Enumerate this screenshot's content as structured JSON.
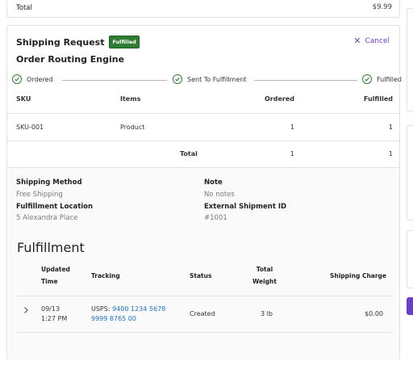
{
  "summary": {
    "total_label": "Total",
    "total_value": "$9.99"
  },
  "shipping_request": {
    "title": "Shipping Request",
    "badge": "Fulfilled",
    "cancel_label": "Cancel",
    "subtitle": "Order Routing Engine",
    "steps": [
      "Ordered",
      "Sent To Fulfillment",
      "Fulfilled"
    ],
    "status_colors": {
      "fulfilled": "#2e7d32",
      "accent": "#6a3ec7",
      "link": "#1a73c8"
    }
  },
  "items_table": {
    "headers": [
      "SKU",
      "Items",
      "Ordered",
      "Fulfilled"
    ],
    "rows": [
      {
        "sku": "SKU-001",
        "item": "Product",
        "ordered": "1",
        "fulfilled": "1"
      }
    ],
    "total": {
      "label": "Total",
      "ordered": "1",
      "fulfilled": "1"
    }
  },
  "details": {
    "shipping_method_label": "Shipping Method",
    "shipping_method": "Free Shipping",
    "note_label": "Note",
    "note": "No notes",
    "fulfillment_location_label": "Fulfillment Location",
    "fulfillment_location": "5 Alexandra Place",
    "external_id_label": "External Shipment ID",
    "external_id": "#1001"
  },
  "fulfillment": {
    "title": "Fulfillment",
    "headers": {
      "updated_time_1": "Updated",
      "updated_time_2": "Time",
      "tracking": "Tracking",
      "status": "Status",
      "total_weight_1": "Total",
      "total_weight_2": "Weight",
      "shipping_charge": "Shipping Charge"
    },
    "rows": [
      {
        "date": "09/13",
        "time": "1:27 PM",
        "carrier": "USPS:",
        "tracking_1": "9400 1234 5678",
        "tracking_2": "9999 8765 00",
        "status": "Created",
        "weight": "3 lb",
        "charge": "$0.00",
        "expand_icon": "chevron-right-icon"
      }
    ]
  }
}
